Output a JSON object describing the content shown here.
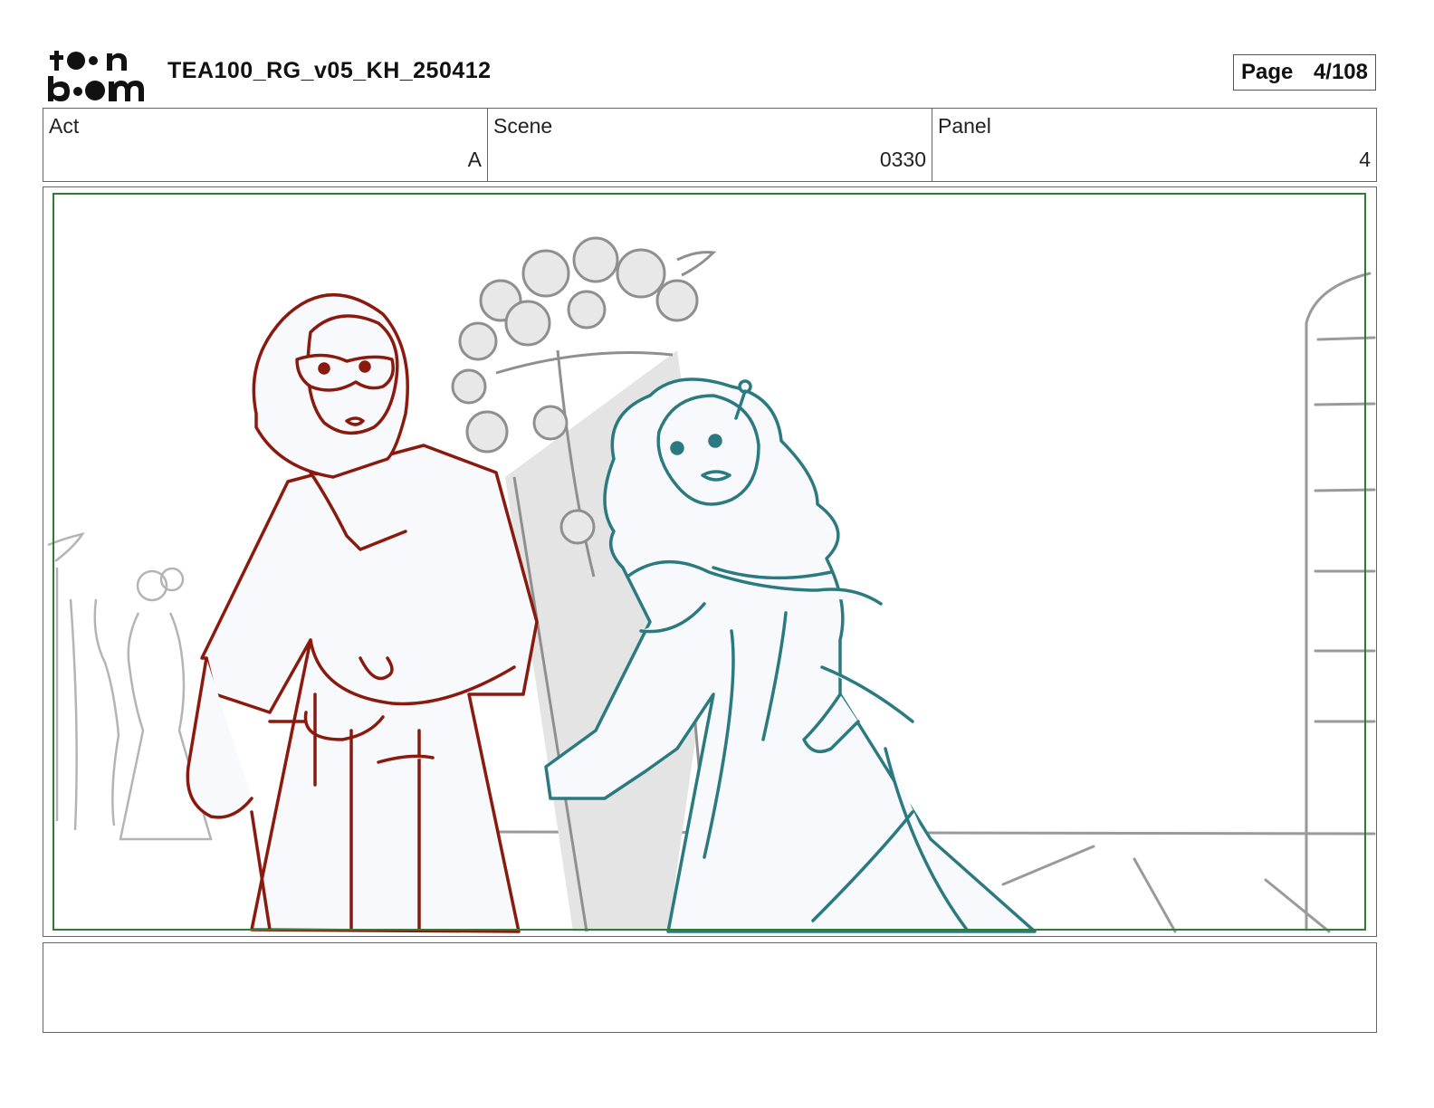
{
  "header": {
    "logo_text": "toon boom",
    "document_title": "TEA100_RG_v05_KH_250412",
    "page_label": "Page",
    "page_value": "4/108"
  },
  "info": {
    "act_label": "Act",
    "act_value": "A",
    "scene_label": "Scene",
    "scene_value": "0330",
    "panel_label": "Panel",
    "panel_value": "4"
  },
  "panel": {
    "safe_frame_color": "#2e7d32",
    "red_character_color": "#8b1a0e",
    "teal_character_color": "#2a7a80",
    "background_line_color": "#9a9a9a"
  },
  "dialogue": {
    "text": ""
  }
}
